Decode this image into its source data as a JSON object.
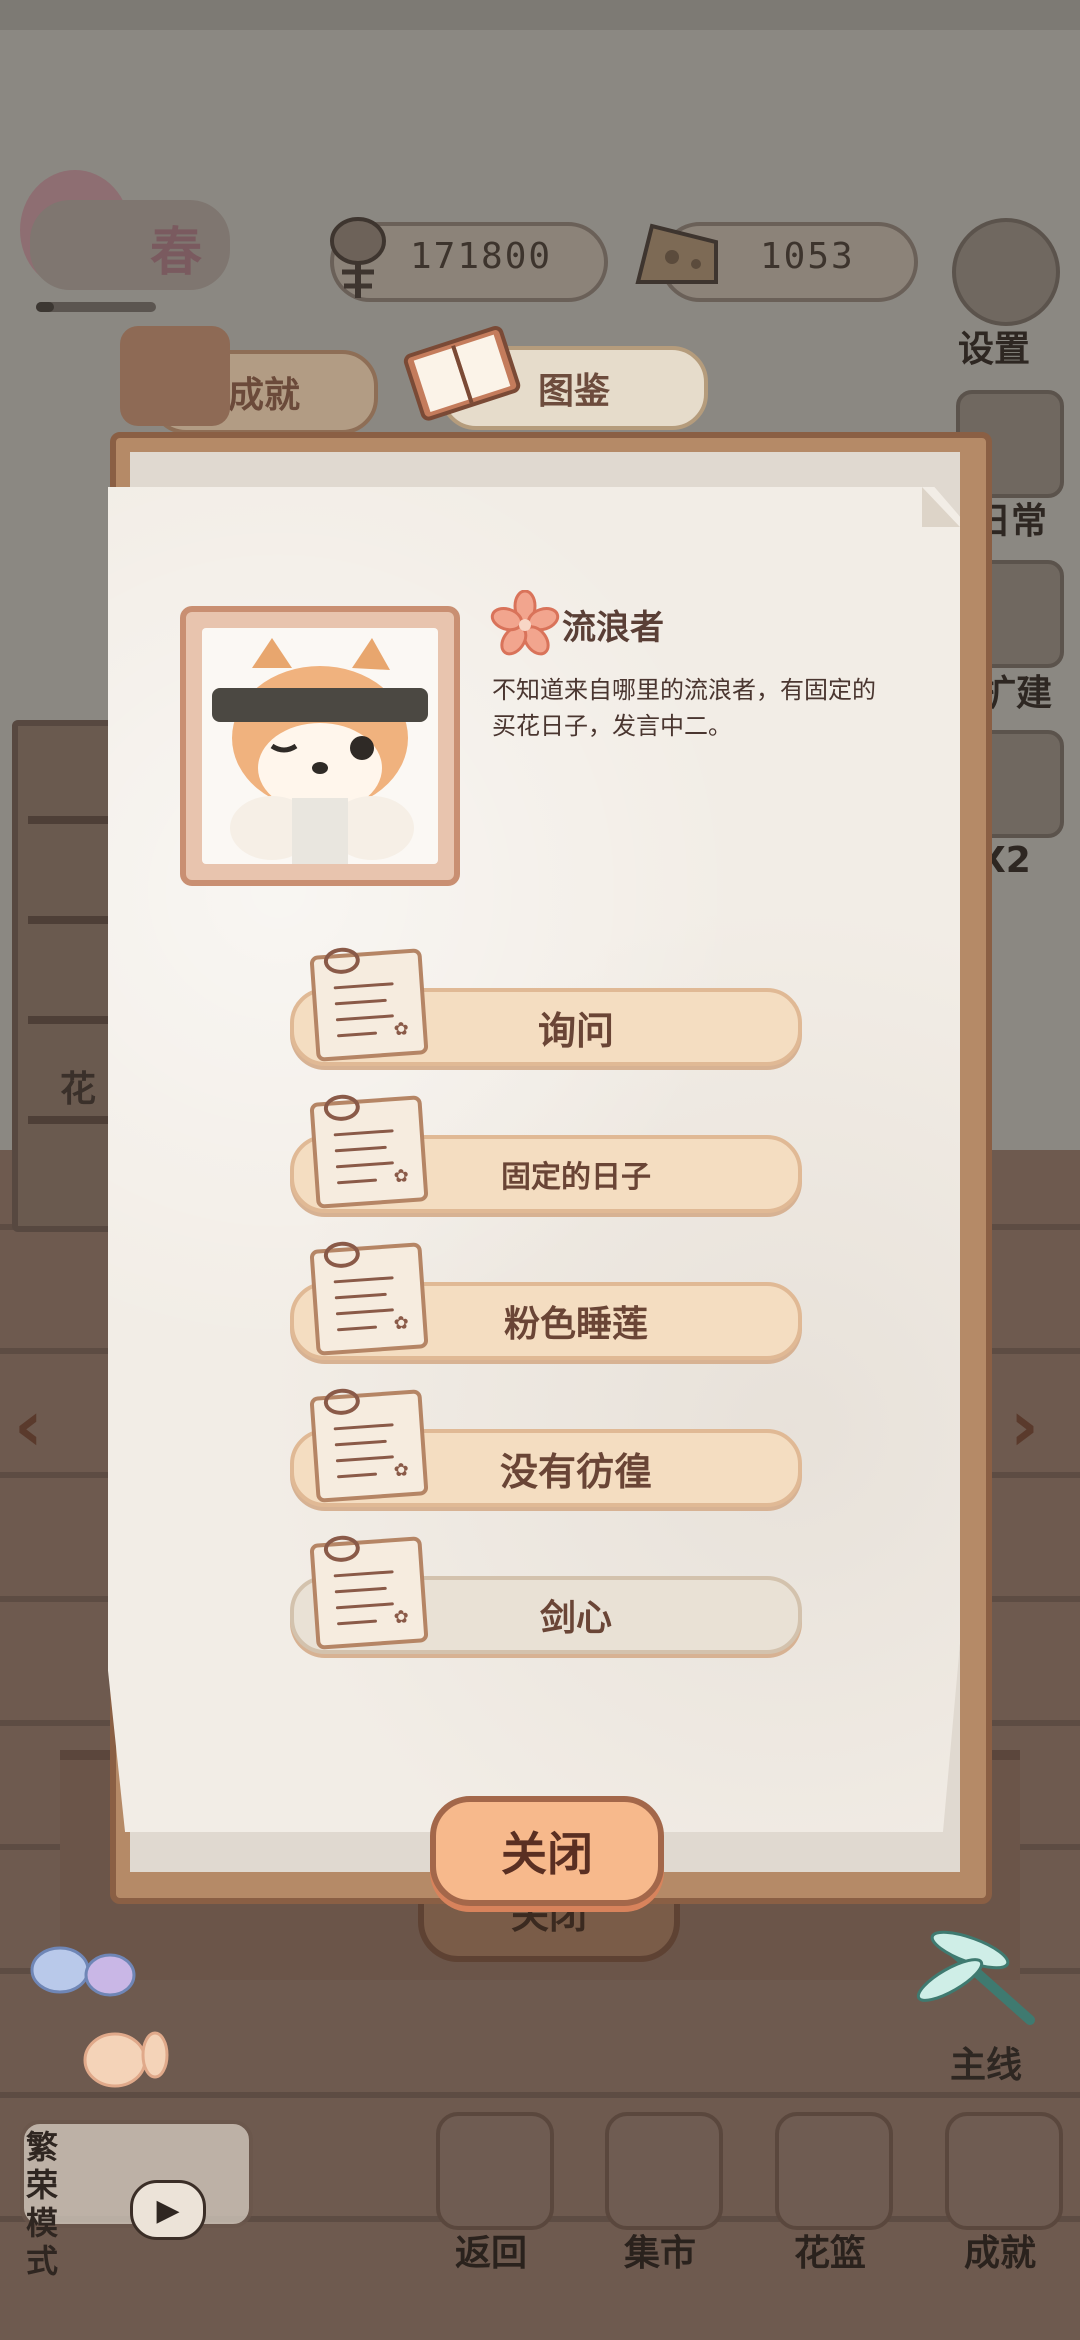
{
  "hud": {
    "season": "春",
    "season_progress": 0.15,
    "fish_count": "171800",
    "cheese_count": "1053"
  },
  "side_menu": {
    "settings": "设置",
    "daily": "日常",
    "build": "扩建",
    "double": "X2",
    "main_quest": "主线"
  },
  "tabs": {
    "achievements": "成就",
    "catalog": "图鉴"
  },
  "dialog": {
    "character_name": "流浪者",
    "character_desc": "不知道来自哪里的流浪者，有固定的买花日子，发言中二。",
    "options": [
      "询问",
      "固定的日子",
      "粉色睡莲",
      "没有彷徨",
      "剑心"
    ],
    "close_label": "关闭"
  },
  "background": {
    "ghost_close_label": "关闭",
    "shelf_label": "花"
  },
  "bottom_bar": {
    "mode_label": "繁荣模式",
    "back": "返回",
    "market": "集市",
    "basket": "花篮",
    "achievements": "成就"
  }
}
